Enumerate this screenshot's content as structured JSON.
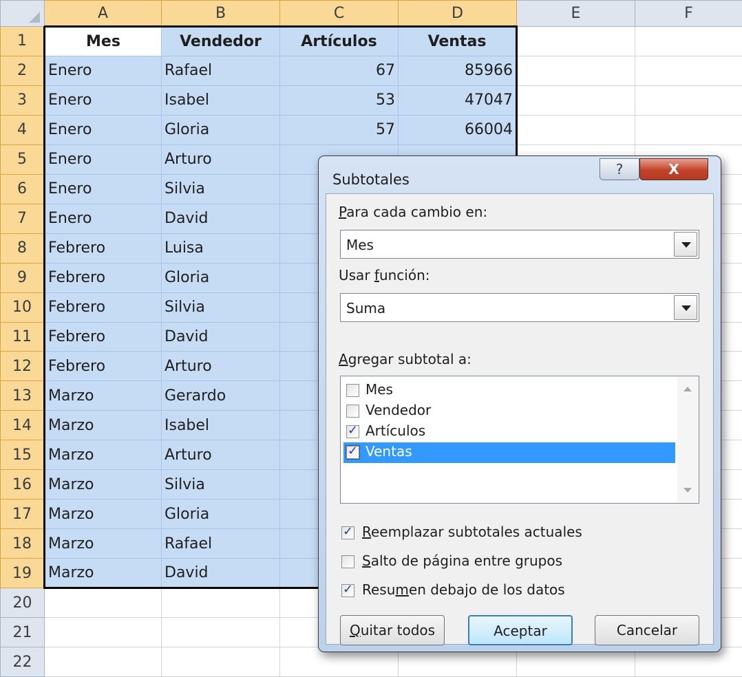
{
  "sheet": {
    "columns": [
      "A",
      "B",
      "C",
      "D",
      "E",
      "F"
    ],
    "selected_columns": [
      "A",
      "B",
      "C",
      "D"
    ],
    "header_row": [
      "Mes",
      "Vendedor",
      "Artículos",
      "Ventas"
    ],
    "data_rows": [
      [
        "Enero",
        "Rafael",
        "67",
        "85966"
      ],
      [
        "Enero",
        "Isabel",
        "53",
        "47047"
      ],
      [
        "Enero",
        "Gloria",
        "57",
        "66004"
      ],
      [
        "Enero",
        "Arturo",
        "",
        ""
      ],
      [
        "Enero",
        "Silvia",
        "",
        ""
      ],
      [
        "Enero",
        "David",
        "",
        ""
      ],
      [
        "Febrero",
        "Luisa",
        "",
        ""
      ],
      [
        "Febrero",
        "Gloria",
        "",
        ""
      ],
      [
        "Febrero",
        "Silvia",
        "",
        ""
      ],
      [
        "Febrero",
        "David",
        "",
        ""
      ],
      [
        "Febrero",
        "Arturo",
        "",
        ""
      ],
      [
        "Marzo",
        "Gerardo",
        "",
        ""
      ],
      [
        "Marzo",
        "Isabel",
        "",
        ""
      ],
      [
        "Marzo",
        "Arturo",
        "",
        ""
      ],
      [
        "Marzo",
        "Silvia",
        "",
        ""
      ],
      [
        "Marzo",
        "Gloria",
        "",
        ""
      ],
      [
        "Marzo",
        "Rafael",
        "",
        ""
      ],
      [
        "Marzo",
        "David",
        "",
        ""
      ]
    ],
    "empty_row_numbers": [
      "20",
      "21",
      "22"
    ],
    "colors": {
      "selection_fill": "#c5dcf4",
      "header_fill": "#dfe5ee",
      "selected_header_fill": "#f9d995"
    }
  },
  "dialog": {
    "title": "Subtotales",
    "help_label": "?",
    "close_label": "X",
    "para_cada_cambio": {
      "label_pre": "",
      "label_key": "P",
      "label_post": "ara cada cambio en:",
      "value": "Mes"
    },
    "usar_funcion": {
      "label_pre": "Usar ",
      "label_key": "f",
      "label_post": "unción:",
      "value": "Suma"
    },
    "agregar_subtotal": {
      "label_pre": "",
      "label_key": "A",
      "label_post": "gregar subtotal a:",
      "items": [
        {
          "label": "Mes",
          "checked": false,
          "selected": false
        },
        {
          "label": "Vendedor",
          "checked": false,
          "selected": false
        },
        {
          "label": "Artículos",
          "checked": true,
          "selected": false
        },
        {
          "label": "Ventas",
          "checked": true,
          "selected": true
        }
      ]
    },
    "options": [
      {
        "pre": "",
        "key": "R",
        "post": "eemplazar subtotales actuales",
        "checked": true
      },
      {
        "pre": "",
        "key": "S",
        "post": "alto de página entre grupos",
        "checked": false
      },
      {
        "pre": "Resu",
        "key": "m",
        "post": "en debajo de los datos",
        "checked": true
      }
    ],
    "buttons": {
      "quitar_pre": "",
      "quitar_key": "Q",
      "quitar_post": "uitar todos",
      "ok": "Aceptar",
      "cancel": "Cancelar"
    },
    "colors": {
      "list_selection": "#3399ff",
      "close_button": "#c2432a",
      "frame": "#bcd1ea"
    }
  }
}
